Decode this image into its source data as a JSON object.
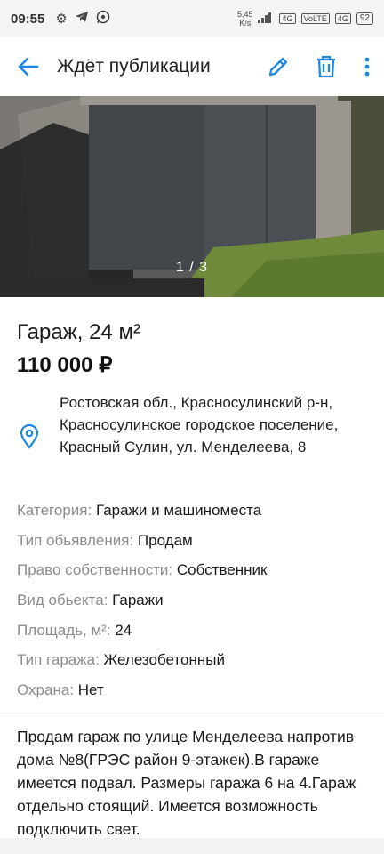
{
  "status_bar": {
    "time": "09:55",
    "speed_value": "5,45",
    "speed_unit": "K/s",
    "signal_1": "4G",
    "volte": "VoLTE",
    "signal_2": "4G",
    "battery": "92"
  },
  "toolbar": {
    "title": "Ждёт публикации"
  },
  "gallery": {
    "counter": "1 / 3"
  },
  "listing": {
    "title": "Гараж, 24 м²",
    "price": "110 000 ₽",
    "address": "Ростовская обл., Красносулинский р-н, Красносулинское городское поселение, Красный Сулин, ул. Менделеева, 8"
  },
  "properties": [
    {
      "label": "Категория:",
      "value": "Гаражи и машиноместа"
    },
    {
      "label": "Тип обьявления:",
      "value": "Продам"
    },
    {
      "label": "Право собственности:",
      "value": "Собственник"
    },
    {
      "label": "Вид обьекта:",
      "value": "Гаражи"
    },
    {
      "label": "Площадь, м²:",
      "value": "24"
    },
    {
      "label": "Тип гаража:",
      "value": "Железобетонный"
    },
    {
      "label": "Охрана:",
      "value": "Нет"
    }
  ],
  "description": "Продам гараж по улице Менделеева напротив дома №8(ГРЭС район 9-этажек).В гараже имеется подвал. Размеры гаража 6 на 4.Гараж отдельно стоящий. Имеется возможность подключить свет.",
  "colors": {
    "accent": "#1e88e5"
  }
}
